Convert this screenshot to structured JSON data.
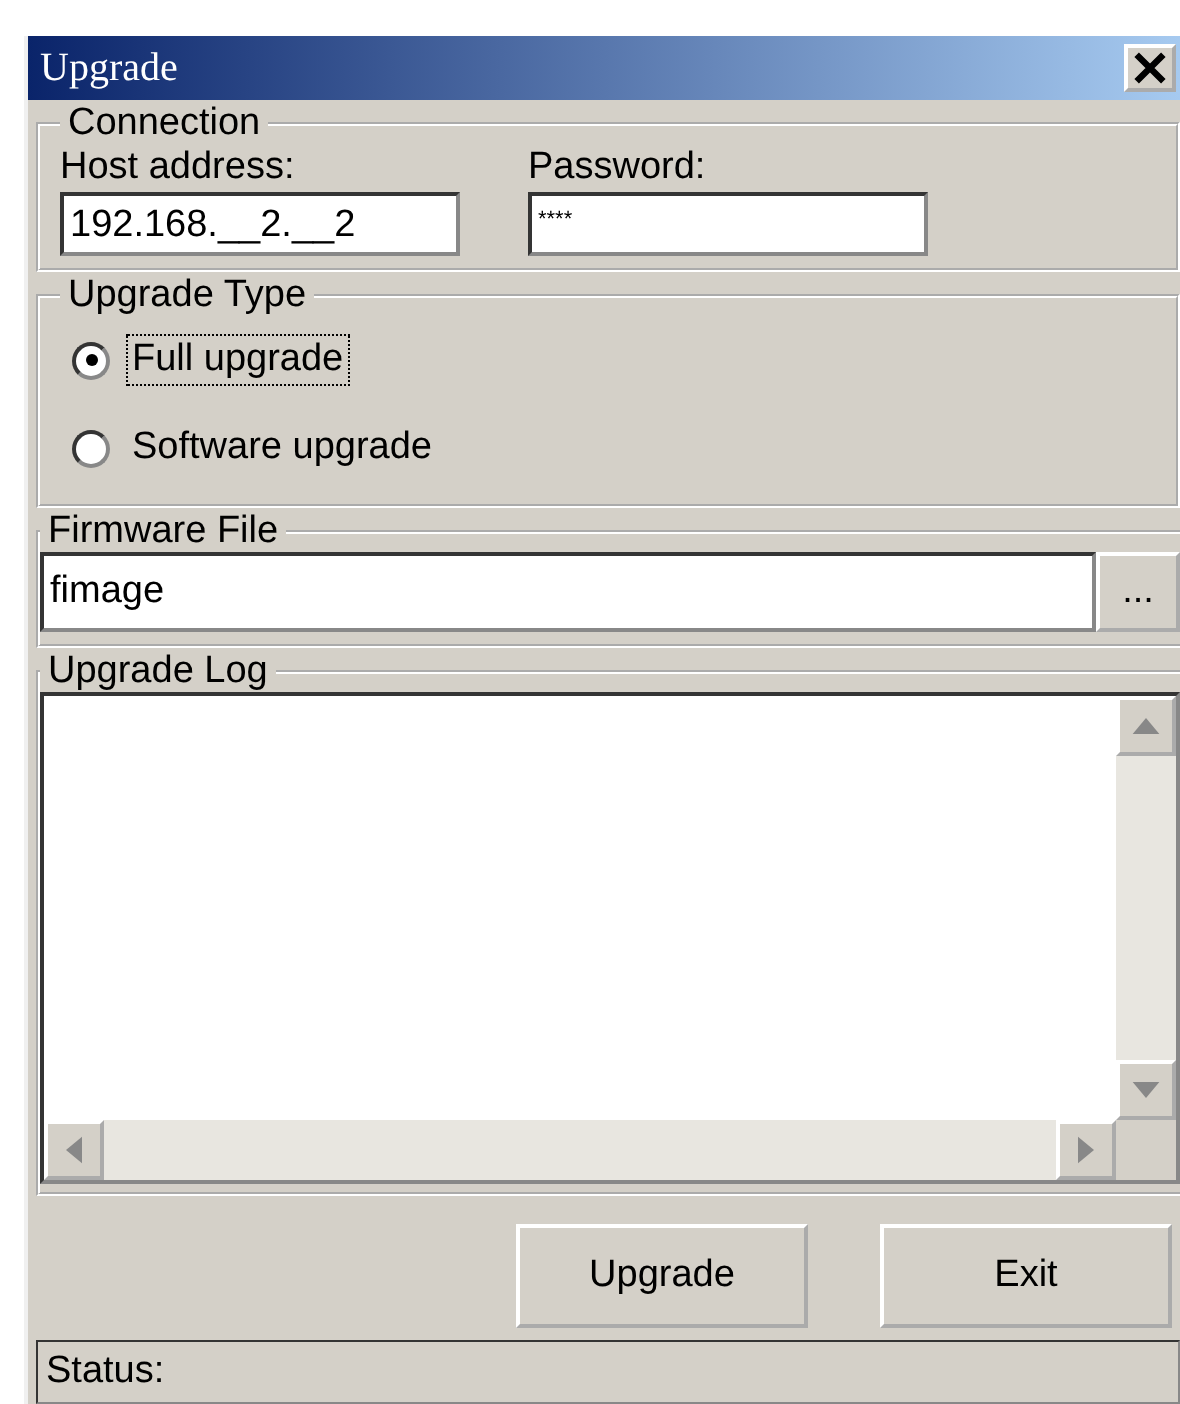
{
  "window": {
    "title": "Upgrade"
  },
  "connection": {
    "title": "Connection",
    "fields": [
      {
        "label": "Host address:",
        "value": "192.168.__2.__2"
      },
      {
        "label": "Password:",
        "value": "****"
      }
    ]
  },
  "upgrade_type": {
    "title": "Upgrade Type",
    "options": [
      {
        "label": "Full upgrade",
        "selected": true,
        "focused": true
      },
      {
        "label": "Software upgrade",
        "selected": false,
        "focused": false
      }
    ]
  },
  "firmware_file": {
    "title": "Firmware File",
    "value": "fimage",
    "browse_button": "..."
  },
  "upgrade_log": {
    "title": "Upgrade Log"
  },
  "buttons": [
    {
      "label": "Upgrade"
    },
    {
      "label": "Exit"
    }
  ],
  "status_bar": {
    "text": "Status:"
  }
}
